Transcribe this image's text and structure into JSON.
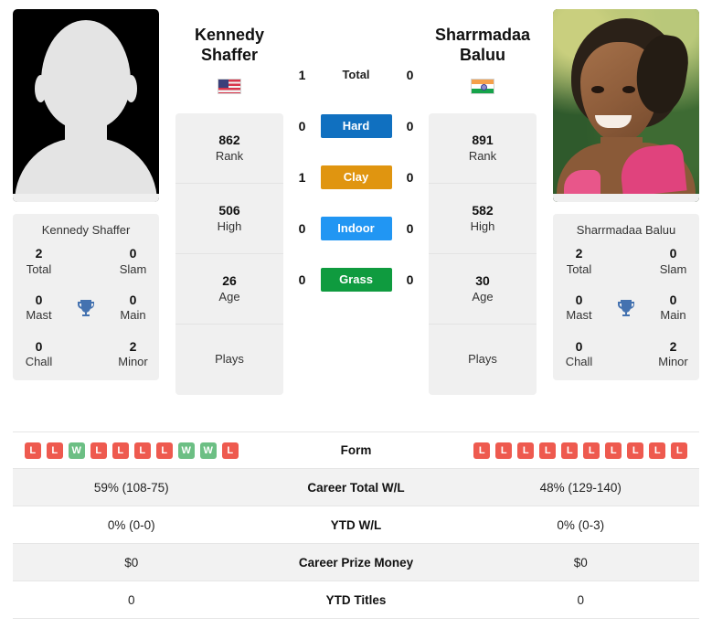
{
  "left_player": {
    "name_line1": "Kennedy",
    "name_line2": "Shaffer",
    "full_name": "Kennedy Shaffer",
    "flag": "us-flag-icon",
    "photo": "placeholder-silhouette",
    "titles": {
      "total_num": "2",
      "total_lbl": "Total",
      "slam_num": "0",
      "slam_lbl": "Slam",
      "mast_num": "0",
      "mast_lbl": "Mast",
      "main_num": "0",
      "main_lbl": "Main",
      "chall_num": "0",
      "chall_lbl": "Chall",
      "minor_num": "2",
      "minor_lbl": "Minor"
    },
    "rank_num": "862",
    "rank_lbl": "Rank",
    "high_num": "506",
    "high_lbl": "High",
    "age_num": "26",
    "age_lbl": "Age",
    "plays_num": "",
    "plays_lbl": "Plays",
    "form": [
      "L",
      "L",
      "W",
      "L",
      "L",
      "L",
      "L",
      "W",
      "W",
      "L"
    ],
    "career_total_wl": "59% (108-75)",
    "ytd_wl": "0% (0-0)",
    "career_prize_money": "$0",
    "ytd_titles": "0"
  },
  "right_player": {
    "name_line1": "Sharrmadaa",
    "name_line2": "Baluu",
    "full_name": "Sharrmadaa Baluu",
    "flag": "india-flag-icon",
    "photo": "player-photo",
    "titles": {
      "total_num": "2",
      "total_lbl": "Total",
      "slam_num": "0",
      "slam_lbl": "Slam",
      "mast_num": "0",
      "mast_lbl": "Mast",
      "main_num": "0",
      "main_lbl": "Main",
      "chall_num": "0",
      "chall_lbl": "Chall",
      "minor_num": "2",
      "minor_lbl": "Minor"
    },
    "rank_num": "891",
    "rank_lbl": "Rank",
    "high_num": "582",
    "high_lbl": "High",
    "age_num": "30",
    "age_lbl": "Age",
    "plays_num": "",
    "plays_lbl": "Plays",
    "form": [
      "L",
      "L",
      "L",
      "L",
      "L",
      "L",
      "L",
      "L",
      "L",
      "L"
    ],
    "career_total_wl": "48% (129-140)",
    "ytd_wl": "0% (0-3)",
    "career_prize_money": "$0",
    "ytd_titles": "0"
  },
  "head_to_head": {
    "rows": [
      {
        "label": "Total",
        "left": "1",
        "right": "0",
        "color": "",
        "style": "plain"
      },
      {
        "label": "Hard",
        "left": "0",
        "right": "0",
        "color": "#1070c0",
        "style": "chip"
      },
      {
        "label": "Clay",
        "left": "1",
        "right": "0",
        "color": "#e09510",
        "style": "chip"
      },
      {
        "label": "Indoor",
        "left": "0",
        "right": "0",
        "color": "#2196f3",
        "style": "chip"
      },
      {
        "label": "Grass",
        "left": "0",
        "right": "0",
        "color": "#0f9b3f",
        "style": "chip"
      }
    ]
  },
  "comparison_table": {
    "rows": [
      {
        "label": "Form",
        "type": "form"
      },
      {
        "label": "Career Total W/L",
        "type": "text",
        "key": "career_total_wl"
      },
      {
        "label": "YTD W/L",
        "type": "text",
        "key": "ytd_wl"
      },
      {
        "label": "Career Prize Money",
        "type": "text",
        "key": "career_prize_money"
      },
      {
        "label": "YTD Titles",
        "type": "text",
        "key": "ytd_titles"
      }
    ]
  },
  "colors": {
    "hard": "#1070c0",
    "clay": "#e09510",
    "indoor": "#2196f3",
    "grass": "#0f9b3f",
    "win_badge": "#6cbf84",
    "loss_badge": "#ee5a4f",
    "panel_bg": "#f0f0f0",
    "trophy": "#4472b0"
  }
}
